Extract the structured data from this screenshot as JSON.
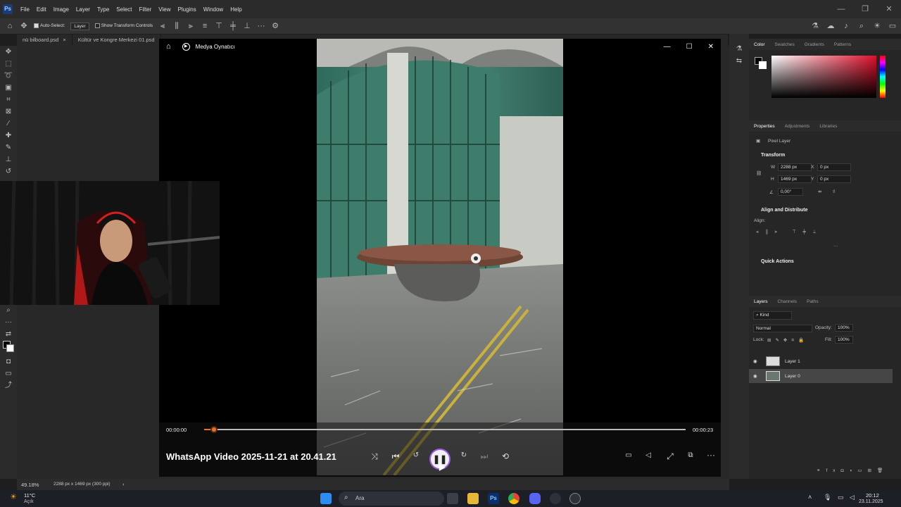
{
  "photoshop": {
    "menu": [
      "File",
      "Edit",
      "Image",
      "Layer",
      "Type",
      "Select",
      "Filter",
      "View",
      "Plugins",
      "Window",
      "Help"
    ],
    "options": {
      "auto_select": "Auto-Select:",
      "auto_select_target": "Layer",
      "show_transform": "Show Transform Controls"
    },
    "doc_tabs": [
      "nü bilboard.psd",
      "Kültür ve Kongre Merkezi 01.psd"
    ],
    "status": {
      "zoom": "49.18%",
      "doc_info": "2288 px x 1469 px (300 ppi)"
    }
  },
  "player": {
    "app_name": "Medya Oynatıcı",
    "video_title": "WhatsApp Video 2025-11-21 at 20.41.21",
    "time_current": "00:00:00",
    "time_total": "00:00:23",
    "progress_fraction": 0.02
  },
  "panels": {
    "color_tabs": [
      "Color",
      "Swatches",
      "Gradients",
      "Patterns"
    ],
    "props_tabs": [
      "Properties",
      "Adjustments",
      "Libraries"
    ],
    "pixel_layer": "Pixel Layer",
    "transform_title": "Transform",
    "w_label": "W",
    "w_value": "2288 px",
    "h_label": "H",
    "h_value": "1469 px",
    "x_label": "X",
    "x_value": "0 px",
    "y_label": "Y",
    "y_value": "0 px",
    "angle_value": "0,00°",
    "align_title": "Align and Distribute",
    "align_label": "Align:",
    "quick_actions": "Quick Actions",
    "layers_tabs": [
      "Layers",
      "Channels",
      "Paths"
    ],
    "kind": "Kind",
    "blend_mode": "Normal",
    "opacity_label": "Opacity:",
    "opacity_value": "100%",
    "lock_label": "Lock:",
    "fill_label": "Fill:",
    "fill_value": "100%",
    "layers": [
      "Layer 1",
      "Layer 0"
    ],
    "accent_color": "#e8702a"
  },
  "taskbar": {
    "temp": "11°C",
    "weather": "Açık",
    "search": "Ara",
    "time": "20:12",
    "date": "23.11.2025"
  }
}
